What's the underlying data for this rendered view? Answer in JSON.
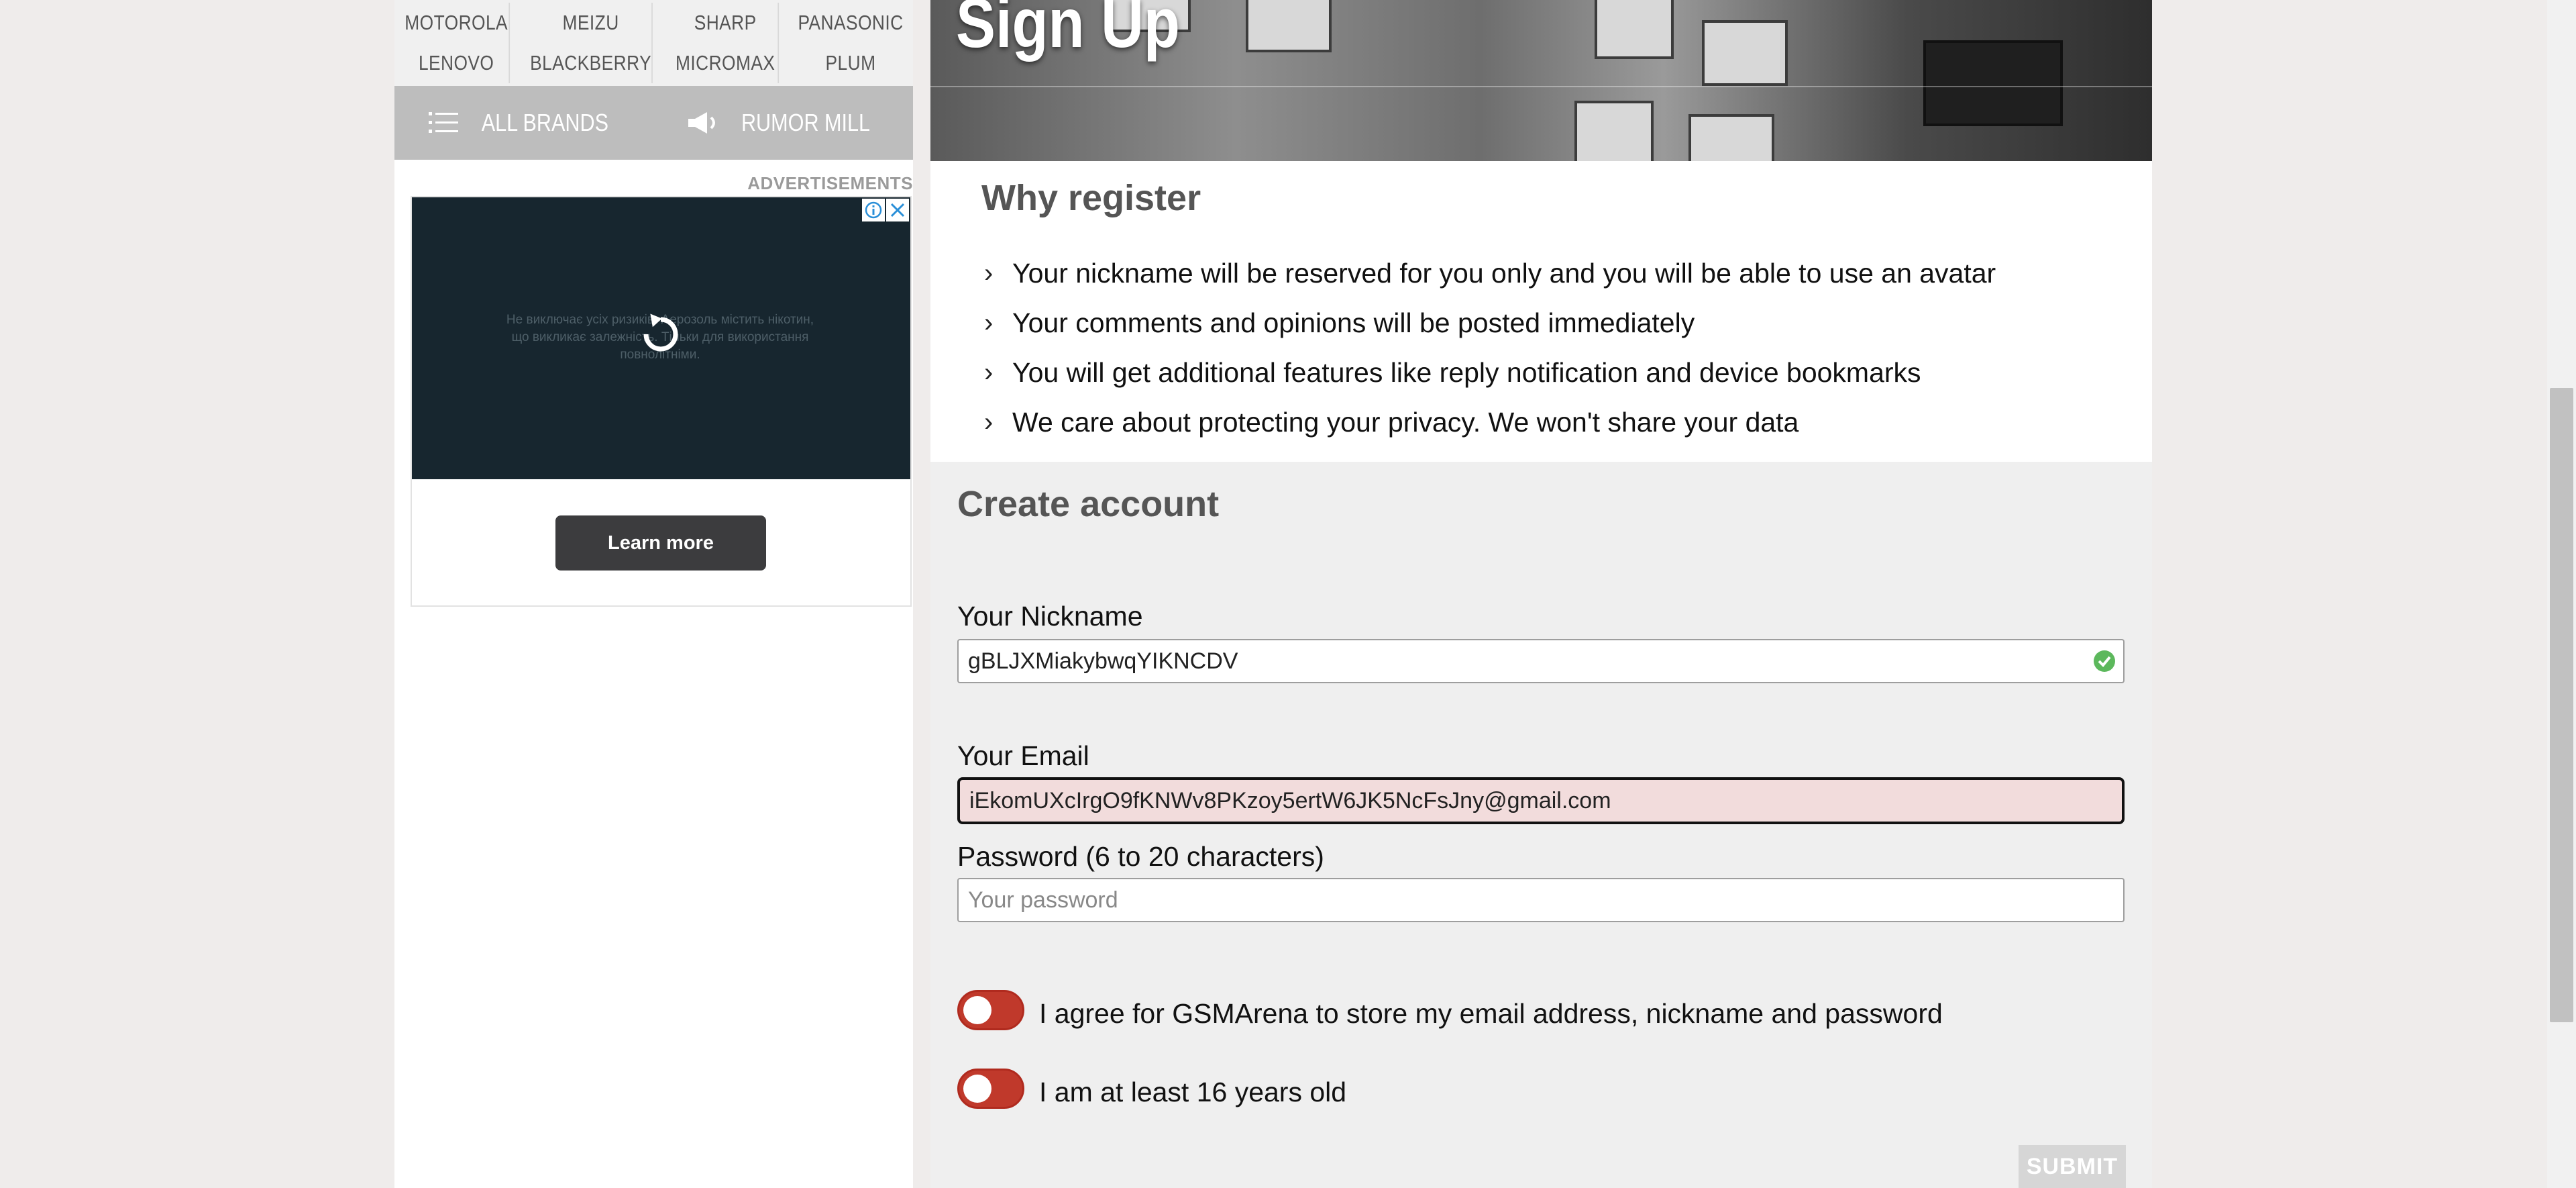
{
  "brands": {
    "row1": [
      "MOTOROLA",
      "MEIZU",
      "SHARP",
      "PANASONIC"
    ],
    "row2": [
      "LENOVO",
      "BLACKBERRY",
      "MICROMAX",
      "PLUM"
    ],
    "all_brands_label": "ALL BRANDS",
    "rumor_mill_label": "RUMOR MILL"
  },
  "ads": {
    "label": "ADVERTISEMENTS",
    "body_text": "Не виключає усіх ризиків. Аерозоль містить нікотин, що викликає залежність. Тільки для використання повнолітніми.",
    "cta_label": "Learn more"
  },
  "hero": {
    "title": "Sign Up"
  },
  "why": {
    "title": "Why register",
    "items": [
      "Your nickname will be reserved for you only and you will be able to use an avatar",
      "Your comments and opinions will be posted immediately",
      "You will get additional features like reply notification and device bookmarks",
      "We care about protecting your privacy. We won't share your data"
    ]
  },
  "form": {
    "title": "Create account",
    "nickname_label": "Your Nickname",
    "nickname_value": "gBLJXMiakybwqYIKNCDV",
    "email_label": "Your Email",
    "email_value": "iEkomUXcIrgO9fKNWv8PKzoy5ertW6JK5NcFsJny@gmail.com",
    "password_label": "Password (6 to 20 characters)",
    "password_placeholder": "Your password",
    "consent_label": "I agree for GSMArena to store my email address, nickname and password",
    "age_label": "I am at least 16 years old",
    "submit_label": "SUBMIT"
  },
  "colors": {
    "toggle_off": "#c0392b",
    "valid_check": "#5cb85c",
    "email_invalid_bg": "#f2dcdc"
  }
}
